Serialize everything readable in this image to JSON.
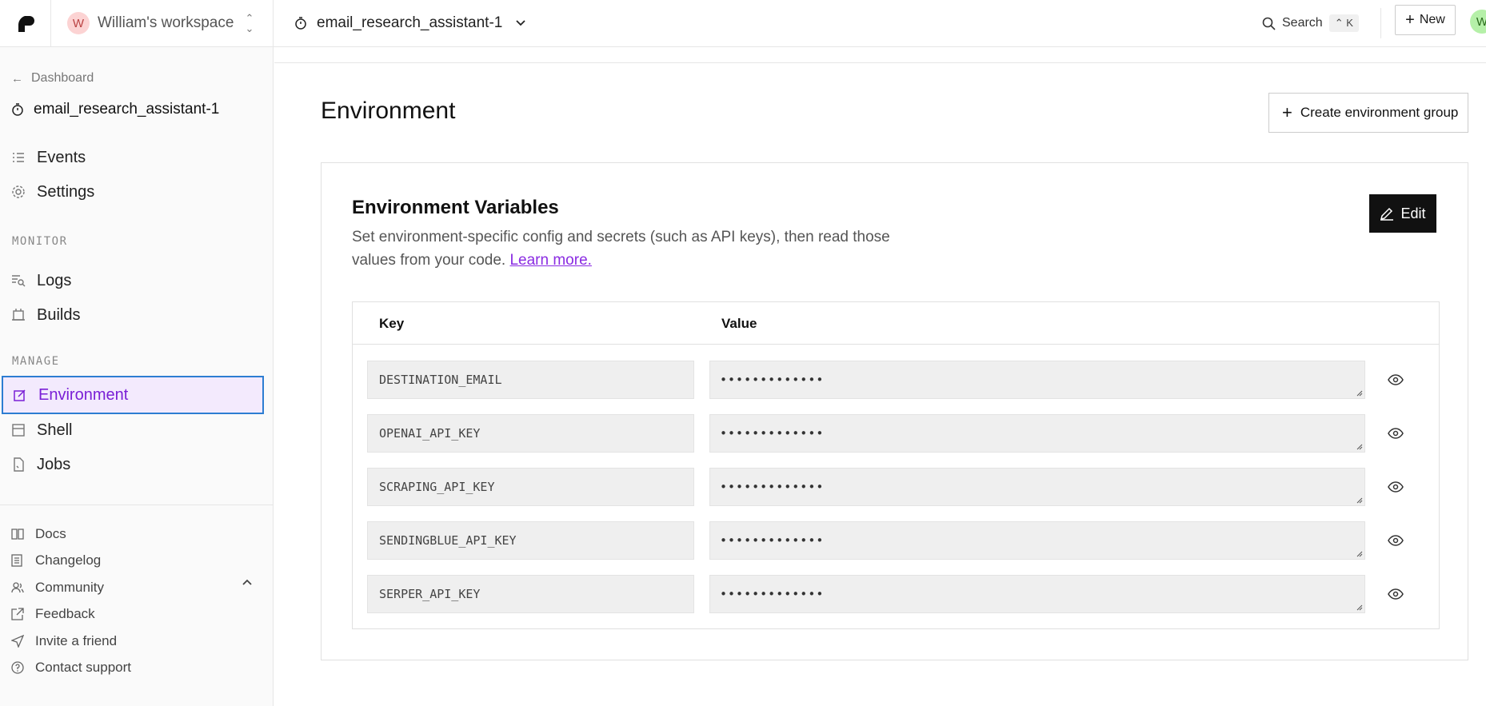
{
  "topbar": {
    "workspace_initial": "W",
    "workspace_name": "William's workspace",
    "service_name": "email_research_assistant-1",
    "search_label": "Search",
    "search_shortcut": "⌃ K",
    "new_label": "New",
    "user_initial": "W"
  },
  "sidebar": {
    "back_label": "Dashboard",
    "service_name": "email_research_assistant-1",
    "items_top": [
      {
        "label": "Events",
        "icon": "list-icon"
      },
      {
        "label": "Settings",
        "icon": "gear-icon"
      }
    ],
    "monitor_heading": "MONITOR",
    "monitor_items": [
      {
        "label": "Logs",
        "icon": "logs-icon"
      },
      {
        "label": "Builds",
        "icon": "builds-icon"
      }
    ],
    "manage_heading": "MANAGE",
    "manage_items": [
      {
        "label": "Environment",
        "icon": "environment-icon",
        "active": true
      },
      {
        "label": "Shell",
        "icon": "shell-icon"
      },
      {
        "label": "Jobs",
        "icon": "jobs-icon"
      }
    ],
    "footer_items": [
      {
        "label": "Docs",
        "icon": "book-icon"
      },
      {
        "label": "Changelog",
        "icon": "changelog-icon"
      },
      {
        "label": "Community",
        "icon": "community-icon"
      },
      {
        "label": "Feedback",
        "icon": "feedback-icon"
      },
      {
        "label": "Invite a friend",
        "icon": "send-icon"
      },
      {
        "label": "Contact support",
        "icon": "help-icon"
      }
    ]
  },
  "main": {
    "title": "Environment",
    "create_group_label": "Create environment group",
    "card": {
      "title": "Environment Variables",
      "description": "Set environment-specific config and secrets (such as API keys), then read those values from your code.",
      "learn_more": "Learn more.",
      "edit_label": "Edit",
      "columns": [
        "Key",
        "Value"
      ],
      "rows": [
        {
          "key": "DESTINATION_EMAIL",
          "value": "•••••••••••••"
        },
        {
          "key": "OPENAI_API_KEY",
          "value": "•••••••••••••"
        },
        {
          "key": "SCRAPING_API_KEY",
          "value": "•••••••••••••"
        },
        {
          "key": "SENDINGBLUE_API_KEY",
          "value": "•••••••••••••"
        },
        {
          "key": "SERPER_API_KEY",
          "value": "•••••••••••••"
        }
      ]
    }
  },
  "colors": {
    "accent": "#7a1fd6",
    "active_bg": "#f3eafd",
    "focus_border": "#2d7dd2",
    "edit_bg": "#111111"
  }
}
